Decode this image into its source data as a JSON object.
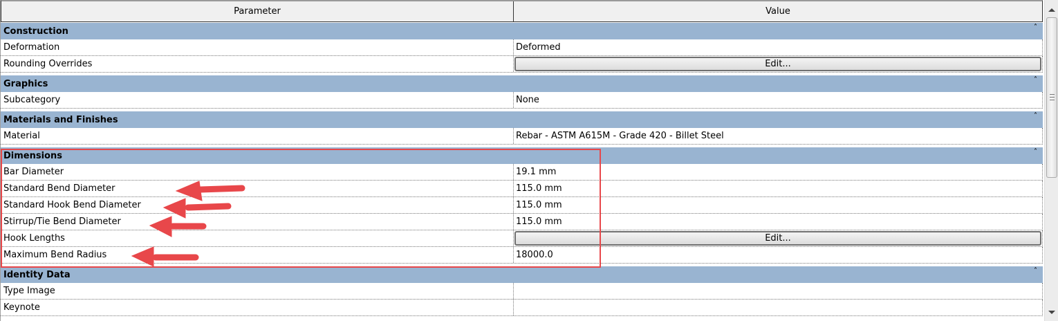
{
  "header": {
    "parameter": "Parameter",
    "value": "Value"
  },
  "sections": [
    {
      "title": "Construction",
      "rows": [
        {
          "param": "Deformation",
          "value": "Deformed"
        },
        {
          "param": "Rounding Overrides",
          "button": "Edit..."
        }
      ]
    },
    {
      "title": "Graphics",
      "rows": [
        {
          "param": "Subcategory",
          "value": "None"
        }
      ]
    },
    {
      "title": "Materials and Finishes",
      "rows": [
        {
          "param": "Material",
          "value": "Rebar - ASTM A615M - Grade 420 - Billet Steel"
        }
      ]
    },
    {
      "title": "Dimensions",
      "rows": [
        {
          "param": "Bar Diameter",
          "value": "19.1 mm"
        },
        {
          "param": "Standard Bend Diameter",
          "value": "115.0 mm"
        },
        {
          "param": "Standard Hook Bend Diameter",
          "value": "115.0 mm"
        },
        {
          "param": "Stirrup/Tie Bend Diameter",
          "value": "115.0 mm"
        },
        {
          "param": "Hook Lengths",
          "button": "Edit..."
        },
        {
          "param": "Maximum Bend Radius",
          "value": "18000.0"
        }
      ]
    },
    {
      "title": "Identity Data",
      "rows": [
        {
          "param": "Type Image",
          "value": ""
        },
        {
          "param": "Keynote",
          "value": ""
        }
      ]
    }
  ],
  "collapse_glyph": "˄",
  "colors": {
    "section": "#99b4d1",
    "highlight": "#e8474a"
  }
}
